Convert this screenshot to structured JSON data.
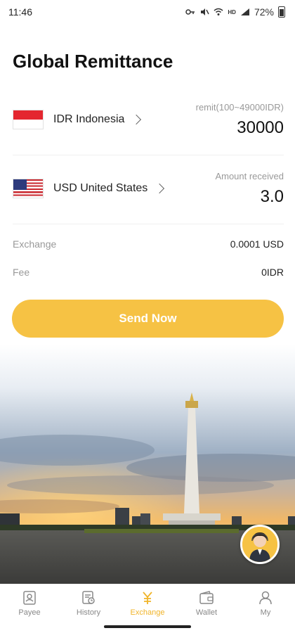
{
  "status_bar": {
    "time": "11:46",
    "battery": "72%"
  },
  "page_title": "Global Remittance",
  "send": {
    "currency_label": "IDR Indonesia",
    "amount_hint": "remit(100~49000IDR)",
    "amount": "30000"
  },
  "receive": {
    "currency_label": "USD United States",
    "amount_hint": "Amount received",
    "amount": "3.0"
  },
  "exchange": {
    "label": "Exchange",
    "value": "0.0001 USD"
  },
  "fee": {
    "label": "Fee",
    "value": "0IDR"
  },
  "send_button_label": "Send Now",
  "tabs": [
    {
      "label": "Payee",
      "icon": "contact-card-icon"
    },
    {
      "label": "History",
      "icon": "history-icon"
    },
    {
      "label": "Exchange",
      "icon": "yuan-exchange-icon",
      "active": true
    },
    {
      "label": "Wallet",
      "icon": "wallet-icon"
    },
    {
      "label": "My",
      "icon": "person-icon"
    }
  ],
  "colors": {
    "accent": "#f6c244",
    "active_tab": "#f0b429"
  }
}
